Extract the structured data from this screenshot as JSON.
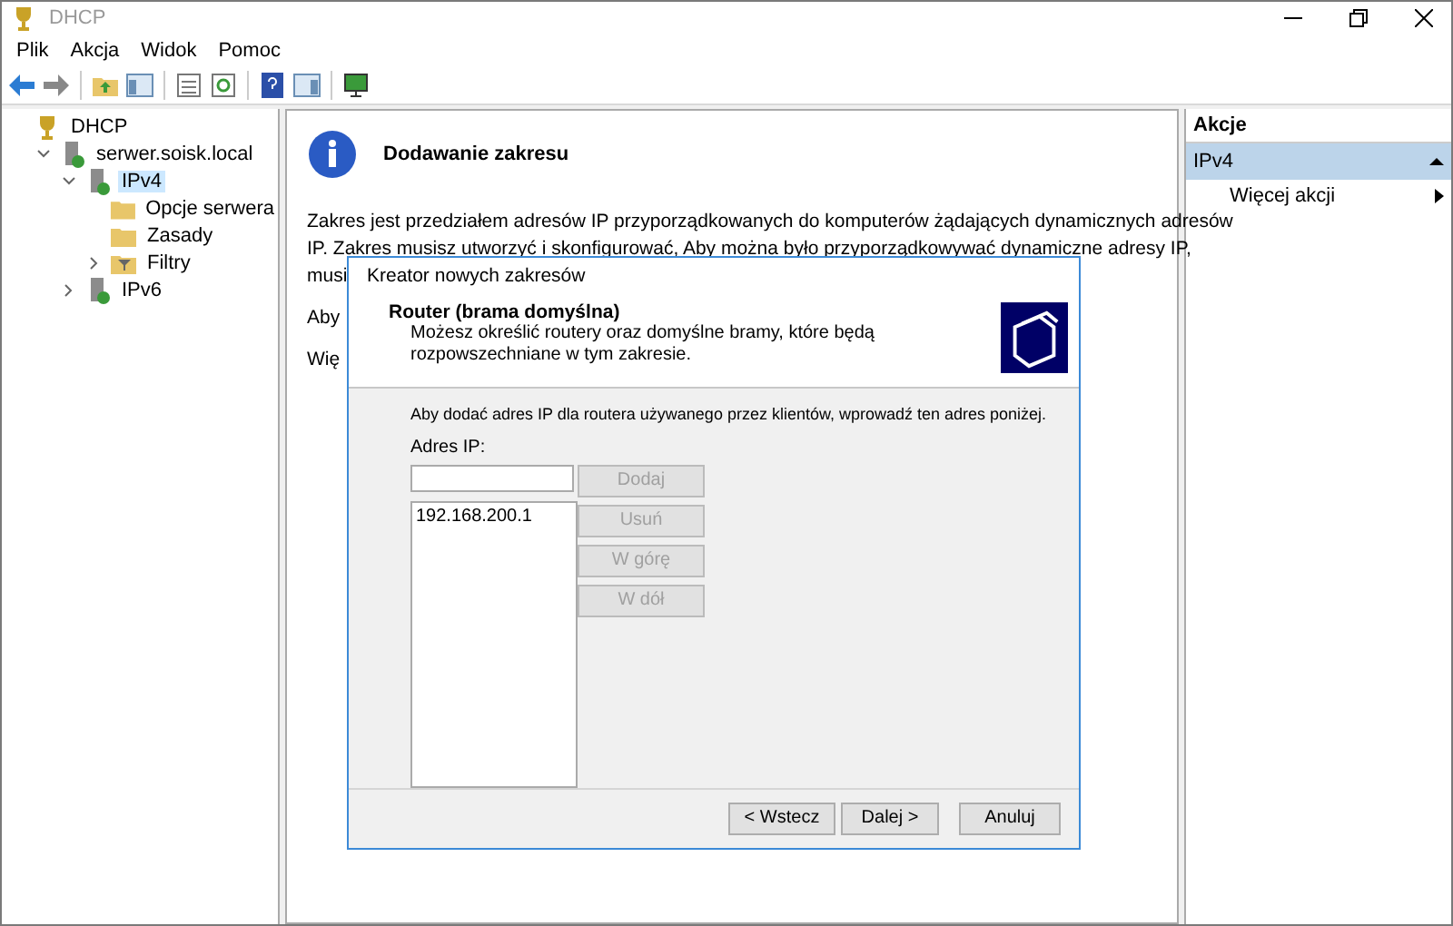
{
  "window": {
    "title": "DHCP"
  },
  "menu": [
    "Plik",
    "Akcja",
    "Widok",
    "Pomoc"
  ],
  "tree": [
    {
      "label": "DHCP",
      "kind": "root",
      "selected": false,
      "children": [
        {
          "label": "serwer.soisk.local",
          "kind": "server",
          "selected": false,
          "expanded": true,
          "children": [
            {
              "label": "IPv4",
              "kind": "server",
              "selected": true,
              "expanded": true,
              "children": [
                {
                  "label": "Opcje serwera",
                  "kind": "folder",
                  "selected": false
                },
                {
                  "label": "Zasady",
                  "kind": "folder",
                  "selected": false
                },
                {
                  "label": "Filtry",
                  "kind": "filter",
                  "selected": false,
                  "expanded": false
                }
              ]
            },
            {
              "label": "IPv6",
              "kind": "server",
              "selected": false,
              "expanded": false
            }
          ]
        }
      ]
    }
  ],
  "content": {
    "heading": "Dodawanie zakresu",
    "lines": [
      "Zakres jest przedziałem adresów IP przyporządkowanych do komputerów żądających dynamicznych adresów",
      "IP. Zakres musisz utworzyć i skonfigurować, Aby można było przyporządkowywać dynamiczne adresy IP,",
      "musi"
    ],
    "partial": [
      "Aby",
      "Wię"
    ]
  },
  "actions": {
    "title": "Akcje",
    "section": "IPv4",
    "items": [
      "Więcej akcji"
    ]
  },
  "dialog": {
    "title": "Kreator nowych zakresów",
    "heading": "Router (brama domyślna)",
    "description": "Możesz określić routery oraz domyślne bramy, które będą rozpowszechniane w tym zakresie.",
    "instruction": "Aby dodać adres IP dla routera używanego przez klientów, wprowadź ten adres poniżej.",
    "ip_label": "Adres IP:",
    "ip_list": [
      "192.168.200.1"
    ],
    "side_buttons": [
      {
        "label": "Dodaj",
        "disabled": true
      },
      {
        "label": "Usuń",
        "disabled": true
      },
      {
        "label": "W górę",
        "disabled": true
      },
      {
        "label": "W dół",
        "disabled": true
      }
    ],
    "buttons": [
      {
        "label": "< Wstecz",
        "disabled": false
      },
      {
        "label": "Dalej >",
        "disabled": false
      },
      {
        "label": "Anuluj",
        "disabled": false
      }
    ]
  }
}
